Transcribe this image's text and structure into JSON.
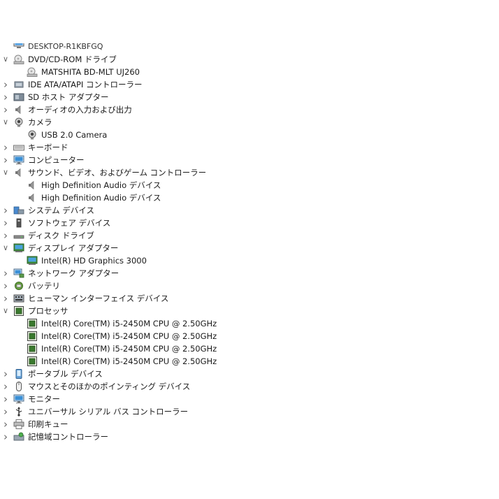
{
  "tree": [
    {
      "label": "DESKTOP-R1KBFGQ",
      "level": 0,
      "expander": "",
      "icon": "computer-icon",
      "cut": true
    },
    {
      "label": "DVD/CD-ROM ドライブ",
      "level": 0,
      "expander": "expanded",
      "icon": "optical-drive-icon"
    },
    {
      "label": "MATSHITA BD-MLT UJ260",
      "level": 1,
      "expander": "",
      "icon": "optical-drive-icon"
    },
    {
      "label": "IDE ATA/ATAPI コントローラー",
      "level": 0,
      "expander": "collapsed",
      "icon": "ide-controller-icon"
    },
    {
      "label": "SD ホスト アダプター",
      "level": 0,
      "expander": "collapsed",
      "icon": "sd-host-icon"
    },
    {
      "label": "オーディオの入力および出力",
      "level": 0,
      "expander": "collapsed",
      "icon": "speaker-icon"
    },
    {
      "label": "カメラ",
      "level": 0,
      "expander": "expanded",
      "icon": "camera-icon"
    },
    {
      "label": "USB 2.0 Camera",
      "level": 1,
      "expander": "",
      "icon": "camera-icon"
    },
    {
      "label": "キーボード",
      "level": 0,
      "expander": "collapsed",
      "icon": "keyboard-icon"
    },
    {
      "label": "コンピューター",
      "level": 0,
      "expander": "collapsed",
      "icon": "monitor-icon"
    },
    {
      "label": "サウンド、ビデオ、およびゲーム コントローラー",
      "level": 0,
      "expander": "expanded",
      "icon": "speaker-icon"
    },
    {
      "label": "High Definition Audio デバイス",
      "level": 1,
      "expander": "",
      "icon": "speaker-icon"
    },
    {
      "label": "High Definition Audio デバイス",
      "level": 1,
      "expander": "",
      "icon": "speaker-icon"
    },
    {
      "label": "システム デバイス",
      "level": 0,
      "expander": "collapsed",
      "icon": "system-device-icon"
    },
    {
      "label": "ソフトウェア デバイス",
      "level": 0,
      "expander": "collapsed",
      "icon": "software-device-icon"
    },
    {
      "label": "ディスク ドライブ",
      "level": 0,
      "expander": "collapsed",
      "icon": "disk-drive-icon"
    },
    {
      "label": "ディスプレイ アダプター",
      "level": 0,
      "expander": "expanded",
      "icon": "display-adapter-icon"
    },
    {
      "label": "Intel(R) HD Graphics 3000",
      "level": 1,
      "expander": "",
      "icon": "display-adapter-icon"
    },
    {
      "label": "ネットワーク アダプター",
      "level": 0,
      "expander": "collapsed",
      "icon": "network-adapter-icon"
    },
    {
      "label": "バッテリ",
      "level": 0,
      "expander": "collapsed",
      "icon": "battery-icon"
    },
    {
      "label": "ヒューマン インターフェイス デバイス",
      "level": 0,
      "expander": "collapsed",
      "icon": "hid-icon"
    },
    {
      "label": "プロセッサ",
      "level": 0,
      "expander": "expanded",
      "icon": "processor-icon"
    },
    {
      "label": "Intel(R) Core(TM) i5-2450M CPU @ 2.50GHz",
      "level": 1,
      "expander": "",
      "icon": "processor-icon"
    },
    {
      "label": "Intel(R) Core(TM) i5-2450M CPU @ 2.50GHz",
      "level": 1,
      "expander": "",
      "icon": "processor-icon"
    },
    {
      "label": "Intel(R) Core(TM) i5-2450M CPU @ 2.50GHz",
      "level": 1,
      "expander": "",
      "icon": "processor-icon"
    },
    {
      "label": "Intel(R) Core(TM) i5-2450M CPU @ 2.50GHz",
      "level": 1,
      "expander": "",
      "icon": "processor-icon"
    },
    {
      "label": "ポータブル デバイス",
      "level": 0,
      "expander": "collapsed",
      "icon": "portable-device-icon"
    },
    {
      "label": "マウスとそのほかのポインティング デバイス",
      "level": 0,
      "expander": "collapsed",
      "icon": "mouse-icon"
    },
    {
      "label": "モニター",
      "level": 0,
      "expander": "collapsed",
      "icon": "monitor-icon"
    },
    {
      "label": "ユニバーサル シリアル バス コントローラー",
      "level": 0,
      "expander": "collapsed",
      "icon": "usb-icon"
    },
    {
      "label": "印刷キュー",
      "level": 0,
      "expander": "collapsed",
      "icon": "printer-icon"
    },
    {
      "label": "記憶域コントローラー",
      "level": 0,
      "expander": "collapsed",
      "icon": "storage-controller-icon"
    }
  ],
  "colors": {
    "text": "#1a1a1a",
    "chevron": "#666666",
    "monitor_blue": "#3a8fd6",
    "chip_green": "#3a7a2e"
  }
}
